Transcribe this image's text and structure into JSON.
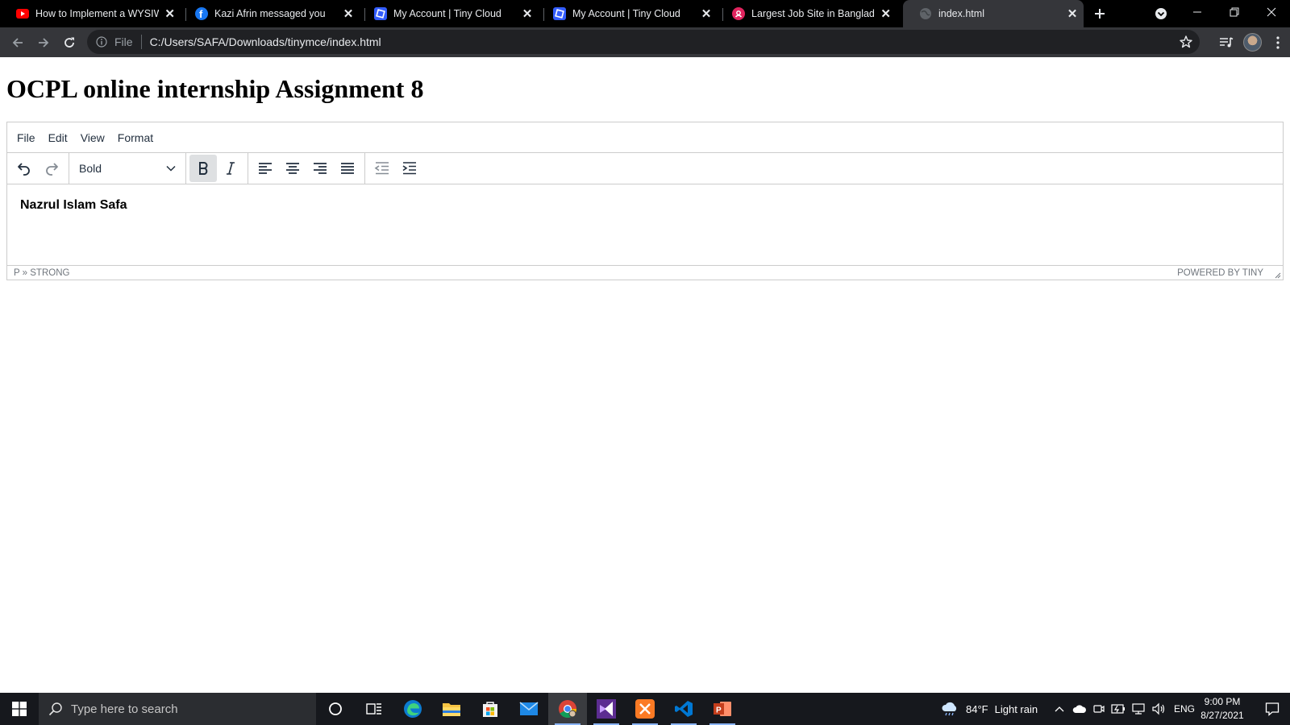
{
  "browser": {
    "tabs": [
      {
        "title": "How to Implement a WYSIWY",
        "favicon": "youtube-icon",
        "active": false
      },
      {
        "title": "Kazi Afrin messaged you",
        "favicon": "facebook-icon",
        "active": false
      },
      {
        "title": "My Account | Tiny Cloud",
        "favicon": "tiny-icon",
        "active": false
      },
      {
        "title": "My Account | Tiny Cloud",
        "favicon": "tiny-icon",
        "active": false
      },
      {
        "title": "Largest Job Site in Banglades",
        "favicon": "bdjobs-icon",
        "active": false
      },
      {
        "title": "index.html",
        "favicon": "globe-icon",
        "active": true
      }
    ],
    "address": {
      "scheme_label": "File",
      "url": "C:/Users/SAFA/Downloads/tinymce/index.html"
    }
  },
  "page": {
    "heading": "OCPL online internship Assignment 8",
    "editor": {
      "menus": [
        "File",
        "Edit",
        "View",
        "Format"
      ],
      "block_format": "Bold",
      "content_text": "Nazrul Islam Safa",
      "path": "P » STRONG",
      "branding": "POWERED BY TINY"
    }
  },
  "taskbar": {
    "search_placeholder": "Type here to search",
    "weather": {
      "temp": "84°F",
      "condition": "Light rain"
    },
    "language": "ENG",
    "time": "9:00 PM",
    "date": "8/27/2021"
  },
  "colors": {
    "tabstrip_bg": "#000000",
    "toolbar_bg": "#35363a",
    "taskbar_bg": "#16181d",
    "editor_border": "#cccccc",
    "active_button_bg": "#dee0e2"
  }
}
